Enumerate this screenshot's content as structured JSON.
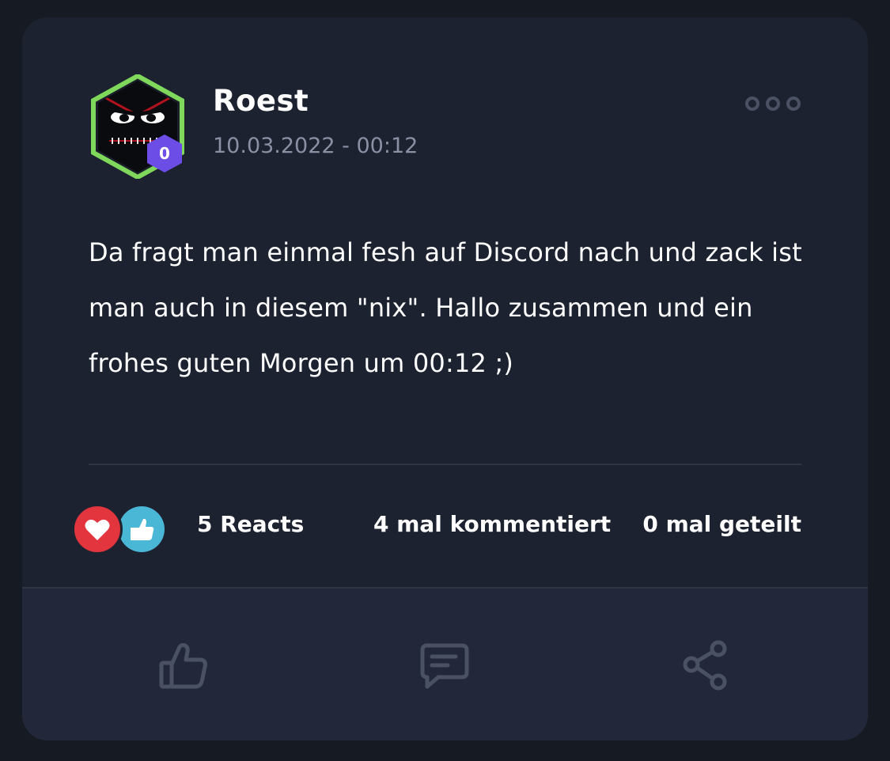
{
  "post": {
    "author": "Roest",
    "timestamp": "10.03.2022 - 00:12",
    "level": "0",
    "text": "Da fragt man einmal fesh auf Discord nach und zack ist man auch in diesem \"nix\". Hallo zusammen und ein frohes guten Morgen um 00:12 ;)"
  },
  "stats": {
    "reacts": "5 Reacts",
    "comments": "4 mal kommentiert",
    "shares": "0 mal geteilt"
  },
  "icons": {
    "more": "more-horizontal-icon",
    "heart_reaction": "heart-icon",
    "like_reaction": "thumbs-up-icon",
    "like_action": "thumbs-up-outline-icon",
    "comment_action": "comment-icon",
    "share_action": "share-icon"
  },
  "colors": {
    "background": "#161a23",
    "card": "#1d2230",
    "footer": "#222839",
    "accent_level": "#6c4ee6",
    "avatar_ring": "#7fd85b",
    "heart": "#e2353d",
    "like": "#4bb7d6",
    "muted_text": "#8a91a4",
    "icon": "#4a5163"
  }
}
